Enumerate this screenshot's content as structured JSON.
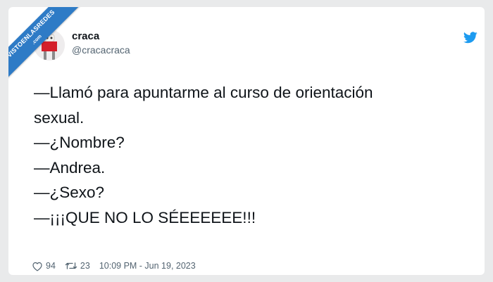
{
  "watermark": {
    "line1": "VISTOENLASREDES",
    "line2": ".com"
  },
  "author": {
    "name": "craca",
    "handle": "@cracacraca"
  },
  "tweet": {
    "lines": [
      "—Llamó para apuntarme al curso de orientación",
      "sexual.",
      "—¿Nombre?",
      "—Andrea.",
      "—¿Sexo?",
      "—¡¡¡QUE NO LO SÉEEEEEE!!!"
    ]
  },
  "metrics": {
    "likes": "94",
    "retweets": "23",
    "timestamp": "10:09 PM - Jun 19, 2023"
  },
  "icons": {
    "brand": "twitter-bird-icon",
    "like": "heart-icon",
    "retweet": "retweet-icon"
  },
  "colors": {
    "twitter_blue": "#1d9bf0",
    "ribbon": "#2e7bc6",
    "text": "#0f1419",
    "muted": "#536471"
  }
}
